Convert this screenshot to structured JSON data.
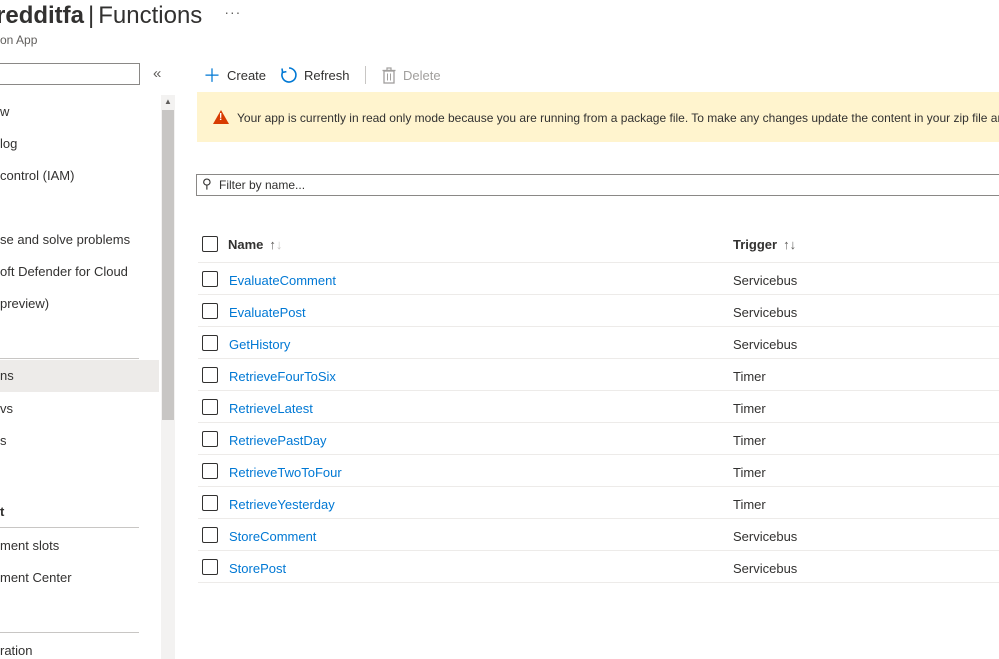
{
  "header": {
    "resource_name": "redditfa",
    "separator": "|",
    "page_title": "Functions",
    "more_label": "···",
    "subtitle": "on App"
  },
  "sidebar": {
    "collapse_label": "«",
    "items": [
      {
        "label": "w"
      },
      {
        "label": "log"
      },
      {
        "label": "control (IAM)"
      },
      {
        "label": "se and solve problems"
      },
      {
        "label": "oft Defender for Cloud"
      },
      {
        "label": "preview)"
      },
      {
        "label": "ns"
      },
      {
        "label": "vs"
      },
      {
        "label": "s"
      },
      {
        "label": "t"
      },
      {
        "label": "ment slots"
      },
      {
        "label": "ment Center"
      },
      {
        "label": "ration"
      }
    ]
  },
  "toolbar": {
    "create_label": "Create",
    "refresh_label": "Refresh",
    "delete_label": "Delete"
  },
  "banner": {
    "text": "Your app is currently in read only mode because you are running from a package file. To make any changes update the content in your zip file an"
  },
  "filter": {
    "placeholder": "Filter by name..."
  },
  "table": {
    "columns": [
      {
        "label": "Name",
        "sort": "↑↓"
      },
      {
        "label": "Trigger",
        "sort": "↑↓"
      }
    ],
    "rows": [
      {
        "name": "EvaluateComment",
        "trigger": "Servicebus"
      },
      {
        "name": "EvaluatePost",
        "trigger": "Servicebus"
      },
      {
        "name": "GetHistory",
        "trigger": "Servicebus"
      },
      {
        "name": "RetrieveFourToSix",
        "trigger": "Timer"
      },
      {
        "name": "RetrieveLatest",
        "trigger": "Timer"
      },
      {
        "name": "RetrievePastDay",
        "trigger": "Timer"
      },
      {
        "name": "RetrieveTwoToFour",
        "trigger": "Timer"
      },
      {
        "name": "RetrieveYesterday",
        "trigger": "Timer"
      },
      {
        "name": "StoreComment",
        "trigger": "Servicebus"
      },
      {
        "name": "StorePost",
        "trigger": "Servicebus"
      }
    ]
  },
  "colors": {
    "accent": "#0078d4",
    "warning_bg": "#fff4ce",
    "warning_icon": "#d83b01"
  },
  "icons": {
    "create": "plus-icon",
    "refresh": "refresh-icon",
    "delete": "trash-icon",
    "warning": "warning-icon",
    "filter": "search-icon",
    "more": "ellipsis-icon"
  }
}
